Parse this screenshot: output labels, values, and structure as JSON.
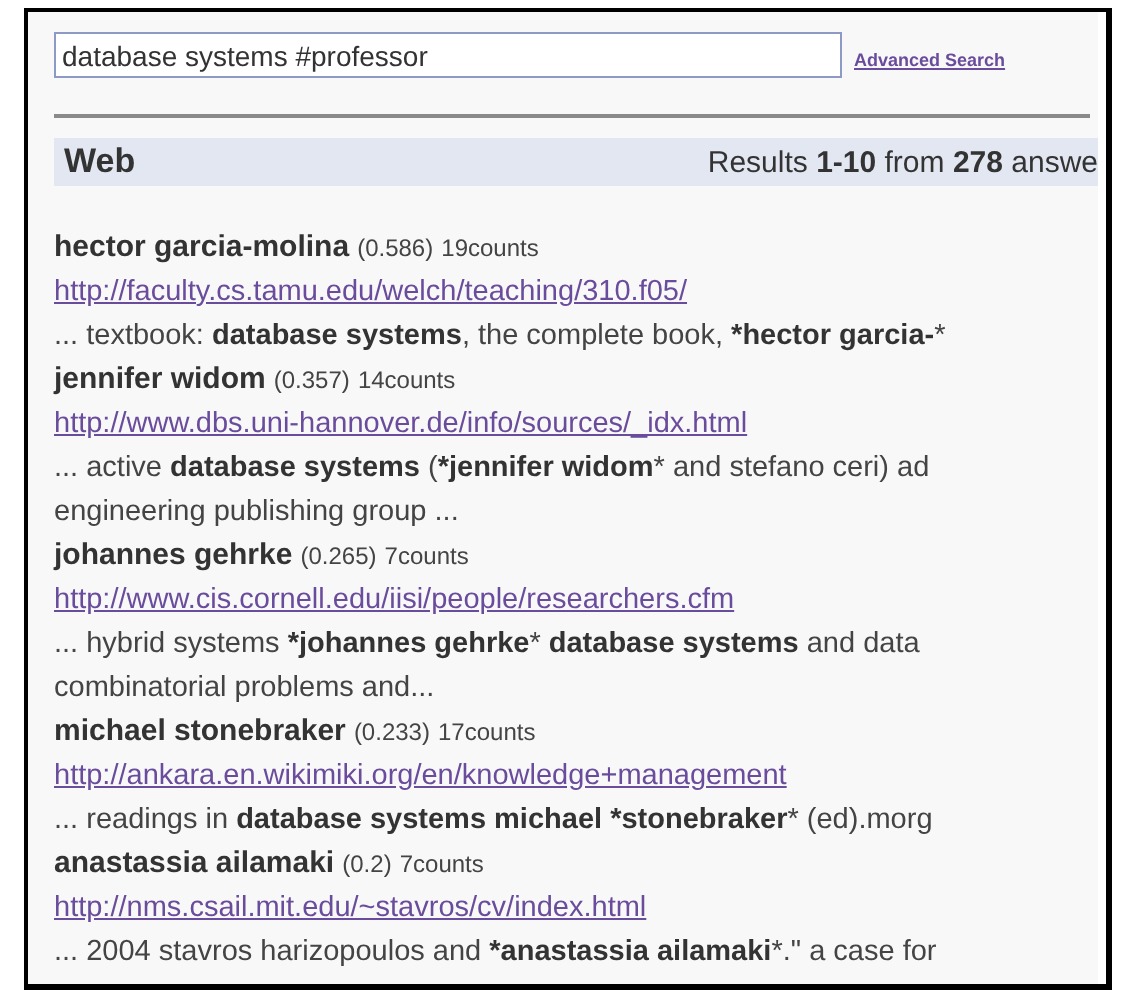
{
  "search": {
    "value": "database systems #professor",
    "advanced_link": "Advanced Search"
  },
  "header": {
    "title": "Web",
    "results": "Results **1-10** from **278** answe"
  },
  "results": [
    {
      "name": "hector garcia-molina",
      "score": "(0.586)",
      "counts": "19counts",
      "url": "http://faculty.cs.tamu.edu/welch/teaching/310.f05/",
      "snippet": [
        "... textbook: **database systems**, the complete book, ***hector garcia-***"
      ]
    },
    {
      "name": "jennifer widom",
      "score": "(0.357)",
      "counts": "14counts",
      "url": "http://www.dbs.uni-hannover.de/info/sources/_idx.html",
      "snippet": [
        "... active **database systems** (***jennifer widom*** and stefano ceri) ad",
        "engineering publishing group ..."
      ]
    },
    {
      "name": "johannes gehrke",
      "score": "(0.265)",
      "counts": "7counts",
      "url": "http://www.cis.cornell.edu/iisi/people/researchers.cfm",
      "snippet": [
        "... hybrid systems ***johannes gehrke*** **database systems** and data",
        "combinatorial problems and..."
      ]
    },
    {
      "name": "michael stonebraker",
      "score": "(0.233)",
      "counts": "17counts",
      "url": "http://ankara.en.wikimiki.org/en/knowledge+management",
      "snippet": [
        "... readings in **database systems michael** ***stonebraker*** (ed).morg"
      ]
    },
    {
      "name": "anastassia ailamaki",
      "score": "(0.2)",
      "counts": "7counts",
      "url": "http://nms.csail.mit.edu/~stavros/cv/index.html",
      "snippet": [
        "... 2004 stavros harizopoulos and ***anastassia ailamaki***.\" a case for"
      ]
    }
  ]
}
